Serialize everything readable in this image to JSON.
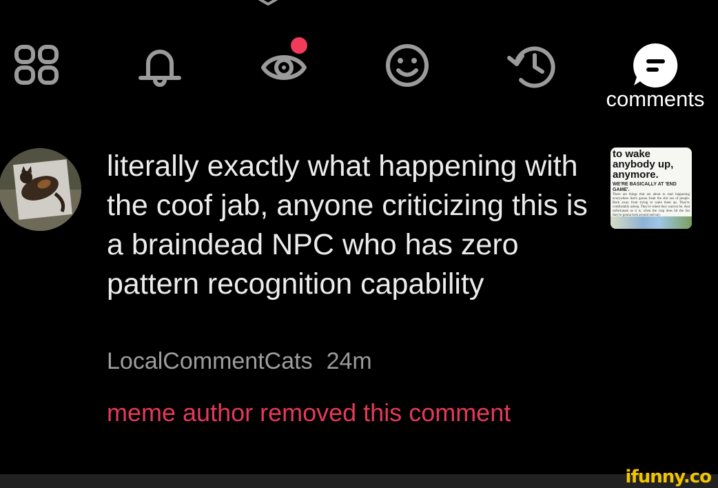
{
  "top_nav": {
    "items": [
      {
        "id": "home",
        "icon": "grid-icon"
      },
      {
        "id": "notifications",
        "icon": "bell-icon"
      },
      {
        "id": "activity",
        "icon": "eye-icon",
        "has_badge": true,
        "badge_color": "#f23a5b"
      },
      {
        "id": "smiles",
        "icon": "smiley-icon"
      },
      {
        "id": "history",
        "icon": "history-icon"
      },
      {
        "id": "comments",
        "icon": "comment-bubble-icon",
        "label": "comments",
        "active": true
      }
    ]
  },
  "comment": {
    "avatar_icon": "cat-avatar",
    "text": "literally exactly what happening with the coof jab, anyone criticizing this is a braindead NPC who has zero pattern recognition capability",
    "author": "LocalCommentCats",
    "time": "24m",
    "status": "meme author removed this comment",
    "thumbnail": {
      "headline": "to wake anybody up, anymore.",
      "subhead": "WE'RE BASICALLY AT 'END GAME'.",
      "body": "There are things that are about to start happening everywhere that's gonna freak the shit out of people. Back away from trying to wake them up. They're comfortably asleep. They're where they want to be. And unfortunate as it is, when the crap does hit the fan they're gonna look around and say:"
    }
  },
  "watermark": "ifunny.co",
  "colors": {
    "background": "#000000",
    "text": "#ececec",
    "meta": "#9e9e9e",
    "removed": "#e33a58",
    "badge": "#f23a5b",
    "watermark": "#f2c500"
  }
}
